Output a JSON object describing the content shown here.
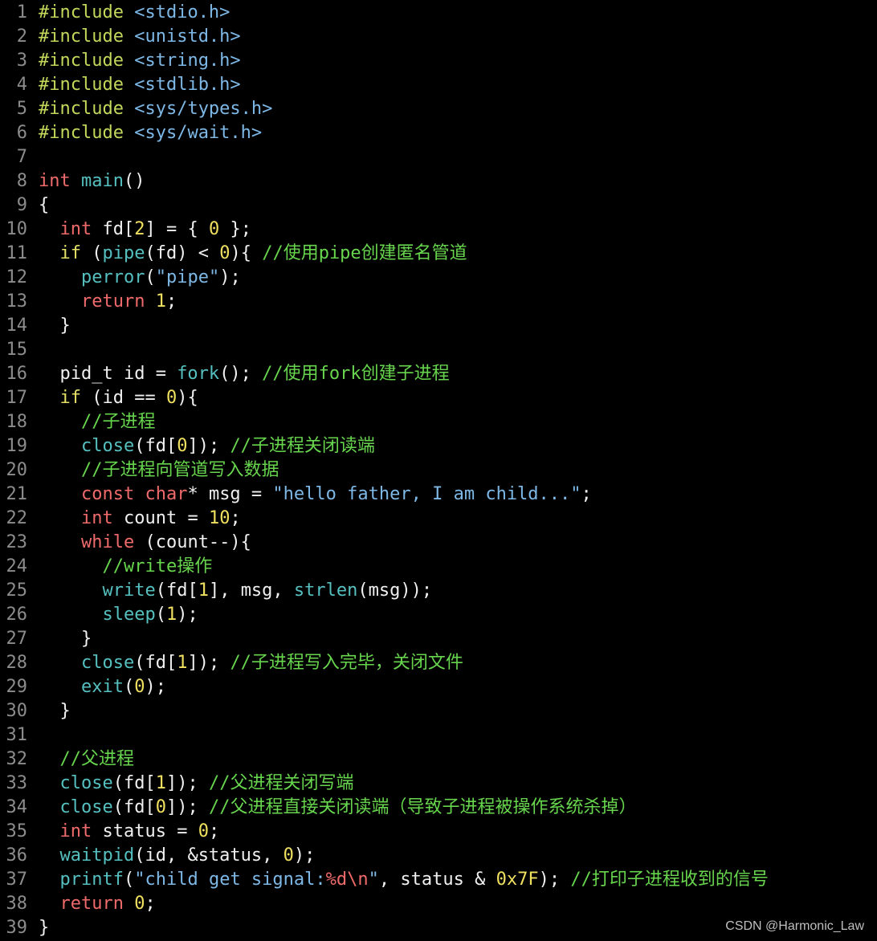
{
  "colors": {
    "default": "#f0f0f0",
    "line_number": "#8c8c8c",
    "preprocessor": "#c3d75b",
    "header": "#7eb8e6",
    "type_keyword": "#ef6a6a",
    "function": "#56c0c0",
    "number": "#f0e060",
    "comment": "#67d54d",
    "string": "#7eb8e6",
    "control_keyword": "#e5e066",
    "escape": "#ef6a6a"
  },
  "code_lines": [
    {
      "n": "1",
      "tokens": [
        [
          "preprocessor",
          "#include"
        ],
        [
          "default",
          " "
        ],
        [
          "header",
          "<stdio.h>"
        ]
      ]
    },
    {
      "n": "2",
      "tokens": [
        [
          "preprocessor",
          "#include"
        ],
        [
          "default",
          " "
        ],
        [
          "header",
          "<unistd.h>"
        ]
      ]
    },
    {
      "n": "3",
      "tokens": [
        [
          "preprocessor",
          "#include"
        ],
        [
          "default",
          " "
        ],
        [
          "header",
          "<string.h>"
        ]
      ]
    },
    {
      "n": "4",
      "tokens": [
        [
          "preprocessor",
          "#include"
        ],
        [
          "default",
          " "
        ],
        [
          "header",
          "<stdlib.h>"
        ]
      ]
    },
    {
      "n": "5",
      "tokens": [
        [
          "preprocessor",
          "#include"
        ],
        [
          "default",
          " "
        ],
        [
          "header",
          "<sys/types.h>"
        ]
      ]
    },
    {
      "n": "6",
      "tokens": [
        [
          "preprocessor",
          "#include"
        ],
        [
          "default",
          " "
        ],
        [
          "header",
          "<sys/wait.h>"
        ]
      ]
    },
    {
      "n": "7",
      "tokens": []
    },
    {
      "n": "8",
      "tokens": [
        [
          "type_keyword",
          "int"
        ],
        [
          "default",
          " "
        ],
        [
          "function",
          "main"
        ],
        [
          "default",
          "()"
        ]
      ]
    },
    {
      "n": "9",
      "tokens": [
        [
          "default",
          "{"
        ]
      ]
    },
    {
      "n": "10",
      "tokens": [
        [
          "default",
          "  "
        ],
        [
          "type_keyword",
          "int"
        ],
        [
          "default",
          " fd["
        ],
        [
          "number",
          "2"
        ],
        [
          "default",
          "] = { "
        ],
        [
          "number",
          "0"
        ],
        [
          "default",
          " };"
        ]
      ]
    },
    {
      "n": "11",
      "tokens": [
        [
          "default",
          "  "
        ],
        [
          "control_keyword",
          "if"
        ],
        [
          "default",
          " ("
        ],
        [
          "function",
          "pipe"
        ],
        [
          "default",
          "(fd) < "
        ],
        [
          "number",
          "0"
        ],
        [
          "default",
          "){ "
        ],
        [
          "comment",
          "//使用pipe创建匿名管道"
        ]
      ]
    },
    {
      "n": "12",
      "tokens": [
        [
          "default",
          "    "
        ],
        [
          "function",
          "perror"
        ],
        [
          "default",
          "("
        ],
        [
          "string",
          "\"pipe\""
        ],
        [
          "default",
          ");"
        ]
      ]
    },
    {
      "n": "13",
      "tokens": [
        [
          "default",
          "    "
        ],
        [
          "type_keyword",
          "return"
        ],
        [
          "default",
          " "
        ],
        [
          "number",
          "1"
        ],
        [
          "default",
          ";"
        ]
      ]
    },
    {
      "n": "14",
      "tokens": [
        [
          "default",
          "  }"
        ]
      ]
    },
    {
      "n": "15",
      "tokens": []
    },
    {
      "n": "16",
      "tokens": [
        [
          "default",
          "  pid_t id = "
        ],
        [
          "function",
          "fork"
        ],
        [
          "default",
          "(); "
        ],
        [
          "comment",
          "//使用fork创建子进程"
        ]
      ]
    },
    {
      "n": "17",
      "tokens": [
        [
          "default",
          "  "
        ],
        [
          "control_keyword",
          "if"
        ],
        [
          "default",
          " (id == "
        ],
        [
          "number",
          "0"
        ],
        [
          "default",
          "){"
        ]
      ]
    },
    {
      "n": "18",
      "tokens": [
        [
          "default",
          "    "
        ],
        [
          "comment",
          "//子进程"
        ]
      ]
    },
    {
      "n": "19",
      "tokens": [
        [
          "default",
          "    "
        ],
        [
          "function",
          "close"
        ],
        [
          "default",
          "(fd["
        ],
        [
          "number",
          "0"
        ],
        [
          "default",
          "]); "
        ],
        [
          "comment",
          "//子进程关闭读端"
        ]
      ]
    },
    {
      "n": "20",
      "tokens": [
        [
          "default",
          "    "
        ],
        [
          "comment",
          "//子进程向管道写入数据"
        ]
      ]
    },
    {
      "n": "21",
      "tokens": [
        [
          "default",
          "    "
        ],
        [
          "type_keyword",
          "const"
        ],
        [
          "default",
          " "
        ],
        [
          "type_keyword",
          "char"
        ],
        [
          "default",
          "* msg = "
        ],
        [
          "string",
          "\"hello father, I am child...\""
        ],
        [
          "default",
          ";"
        ]
      ]
    },
    {
      "n": "22",
      "tokens": [
        [
          "default",
          "    "
        ],
        [
          "type_keyword",
          "int"
        ],
        [
          "default",
          " count = "
        ],
        [
          "number",
          "10"
        ],
        [
          "default",
          ";"
        ]
      ]
    },
    {
      "n": "23",
      "tokens": [
        [
          "default",
          "    "
        ],
        [
          "type_keyword",
          "while"
        ],
        [
          "default",
          " (count--){"
        ]
      ]
    },
    {
      "n": "24",
      "tokens": [
        [
          "default",
          "      "
        ],
        [
          "comment",
          "//write操作"
        ]
      ]
    },
    {
      "n": "25",
      "tokens": [
        [
          "default",
          "      "
        ],
        [
          "function",
          "write"
        ],
        [
          "default",
          "(fd["
        ],
        [
          "number",
          "1"
        ],
        [
          "default",
          "], msg, "
        ],
        [
          "function",
          "strlen"
        ],
        [
          "default",
          "(msg));"
        ]
      ]
    },
    {
      "n": "26",
      "tokens": [
        [
          "default",
          "      "
        ],
        [
          "function",
          "sleep"
        ],
        [
          "default",
          "("
        ],
        [
          "number",
          "1"
        ],
        [
          "default",
          ");"
        ]
      ]
    },
    {
      "n": "27",
      "tokens": [
        [
          "default",
          "    }"
        ]
      ]
    },
    {
      "n": "28",
      "tokens": [
        [
          "default",
          "    "
        ],
        [
          "function",
          "close"
        ],
        [
          "default",
          "(fd["
        ],
        [
          "number",
          "1"
        ],
        [
          "default",
          "]); "
        ],
        [
          "comment",
          "//子进程写入完毕，关闭文件"
        ]
      ]
    },
    {
      "n": "29",
      "tokens": [
        [
          "default",
          "    "
        ],
        [
          "function",
          "exit"
        ],
        [
          "default",
          "("
        ],
        [
          "number",
          "0"
        ],
        [
          "default",
          ");"
        ]
      ]
    },
    {
      "n": "30",
      "tokens": [
        [
          "default",
          "  }"
        ]
      ]
    },
    {
      "n": "31",
      "tokens": []
    },
    {
      "n": "32",
      "tokens": [
        [
          "default",
          "  "
        ],
        [
          "comment",
          "//父进程"
        ]
      ]
    },
    {
      "n": "33",
      "tokens": [
        [
          "default",
          "  "
        ],
        [
          "function",
          "close"
        ],
        [
          "default",
          "(fd["
        ],
        [
          "number",
          "1"
        ],
        [
          "default",
          "]); "
        ],
        [
          "comment",
          "//父进程关闭写端"
        ]
      ]
    },
    {
      "n": "34",
      "tokens": [
        [
          "default",
          "  "
        ],
        [
          "function",
          "close"
        ],
        [
          "default",
          "(fd["
        ],
        [
          "number",
          "0"
        ],
        [
          "default",
          "]); "
        ],
        [
          "comment",
          "//父进程直接关闭读端（导致子进程被操作系统杀掉）"
        ]
      ]
    },
    {
      "n": "35",
      "tokens": [
        [
          "default",
          "  "
        ],
        [
          "type_keyword",
          "int"
        ],
        [
          "default",
          " status = "
        ],
        [
          "number",
          "0"
        ],
        [
          "default",
          ";"
        ]
      ]
    },
    {
      "n": "36",
      "tokens": [
        [
          "default",
          "  "
        ],
        [
          "function",
          "waitpid"
        ],
        [
          "default",
          "(id, &status, "
        ],
        [
          "number",
          "0"
        ],
        [
          "default",
          ");"
        ]
      ]
    },
    {
      "n": "37",
      "tokens": [
        [
          "default",
          "  "
        ],
        [
          "function",
          "printf"
        ],
        [
          "default",
          "("
        ],
        [
          "string",
          "\"child get signal:"
        ],
        [
          "escape",
          "%d\\n"
        ],
        [
          "string",
          "\""
        ],
        [
          "default",
          ", status & "
        ],
        [
          "number",
          "0x7F"
        ],
        [
          "default",
          "); "
        ],
        [
          "comment",
          "//打印子进程收到的信号"
        ]
      ]
    },
    {
      "n": "38",
      "tokens": [
        [
          "default",
          "  "
        ],
        [
          "type_keyword",
          "return"
        ],
        [
          "default",
          " "
        ],
        [
          "number",
          "0"
        ],
        [
          "default",
          ";"
        ]
      ]
    },
    {
      "n": "39",
      "tokens": [
        [
          "default",
          "}"
        ]
      ]
    }
  ],
  "watermark": "CSDN @Harmonic_Law"
}
